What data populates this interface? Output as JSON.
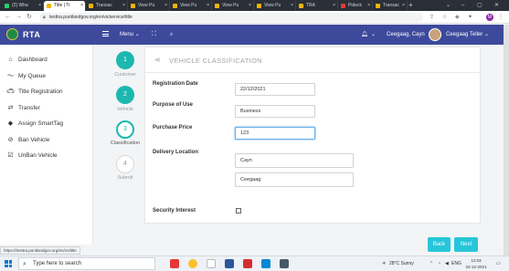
{
  "browser": {
    "tabs": [
      {
        "label": "(2) Wha"
      },
      {
        "label": "Title | Tr"
      },
      {
        "label": "Transac"
      },
      {
        "label": "View Pu"
      },
      {
        "label": "View Pu"
      },
      {
        "label": "View Pu"
      },
      {
        "label": "View Pu"
      },
      {
        "label": "TRA"
      },
      {
        "label": "Pideck"
      },
      {
        "label": "Transac"
      }
    ],
    "new_tab": "+",
    "url": "testtra.puntlandgov.org/en/vn/service/title",
    "profile_initial": "M"
  },
  "app": {
    "title": "RTA",
    "menu_label": "Menu",
    "user_name": "Ceegaag, Cayn",
    "user_role": "Ceegaag Teller"
  },
  "sidebar": {
    "items": [
      {
        "label": "Dashboard",
        "icon": "home-icon"
      },
      {
        "label": "My Queue",
        "icon": "queue-icon"
      },
      {
        "label": "Title Registration",
        "icon": "car-icon"
      },
      {
        "label": "Transfer",
        "icon": "transfer-icon"
      },
      {
        "label": "Assign SmartTag",
        "icon": "tag-icon"
      },
      {
        "label": "Ban Vehicle",
        "icon": "ban-icon"
      },
      {
        "label": "UnBan Vehicle",
        "icon": "unban-icon"
      }
    ]
  },
  "stepper": {
    "steps": [
      {
        "number": "1",
        "label": "Customer",
        "state": "done"
      },
      {
        "number": "2",
        "label": "Vehicle",
        "state": "done"
      },
      {
        "number": "3",
        "label": "Classification",
        "state": "current"
      },
      {
        "number": "4",
        "label": "Submit",
        "state": "pending"
      }
    ]
  },
  "form": {
    "title": "VEHICLE CLASSIFICATION",
    "registration_date": {
      "label": "Registration Date",
      "value": "22/12/2021"
    },
    "purpose_of_use": {
      "label": "Purpose of Use",
      "value": "Business"
    },
    "purchase_price": {
      "label": "Purchase Price",
      "value": "123"
    },
    "delivery_location": {
      "label": "Delivery Location",
      "line1": "Cayn",
      "line2": "Ceegaag"
    },
    "security_interest": {
      "label": "Security Interest",
      "checked": false
    }
  },
  "buttons": {
    "back": "Back",
    "next": "Next"
  },
  "status_url": "https://testtra.puntlandgov.org/en/vn/title",
  "taskbar": {
    "search_placeholder": "Type here to search",
    "weather": "28°C  Sunny",
    "language": "ENG",
    "time": "11:03",
    "date": "22-12-2021"
  },
  "colors": {
    "header": "#3d4a9c",
    "accent": "#1cb8b0",
    "button": "#26c6da"
  }
}
